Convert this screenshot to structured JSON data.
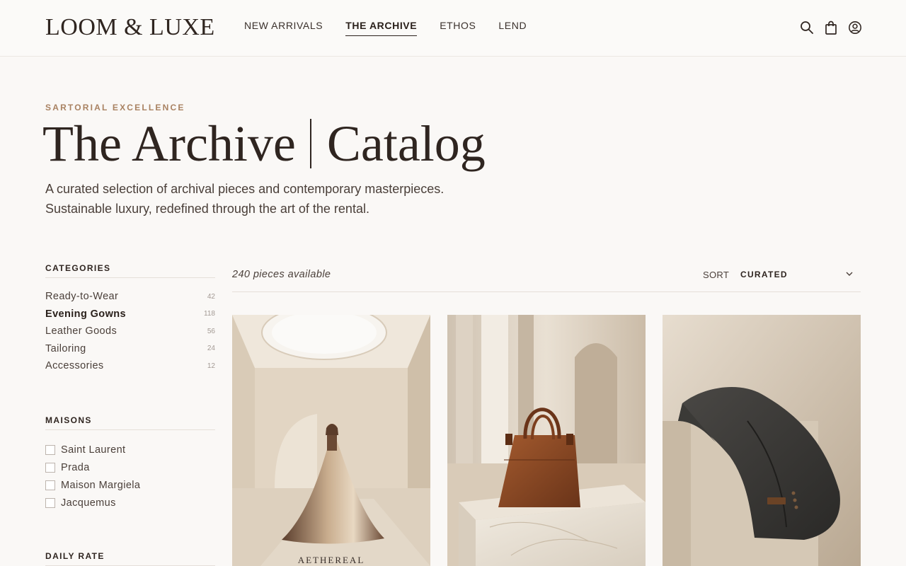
{
  "brand": {
    "logo": "LOOM & LUXE"
  },
  "nav": {
    "items": [
      {
        "label": "NEW ARRIVALS",
        "active": false
      },
      {
        "label": "THE ARCHIVE",
        "active": true
      },
      {
        "label": "ETHOS",
        "active": false
      },
      {
        "label": "LEND",
        "active": false
      }
    ]
  },
  "header_icons": [
    "search-icon",
    "bag-icon",
    "account-icon"
  ],
  "hero": {
    "eyebrow": "SARTORIAL EXCELLENCE",
    "title_left": "The Archive",
    "title_right": "Catalog",
    "subtitle_line1": "A curated selection of archival pieces and contemporary masterpieces.",
    "subtitle_line2": "Sustainable luxury, redefined through the art of the rental."
  },
  "sidebar": {
    "categories_heading": "CATEGORIES",
    "categories": [
      {
        "label": "Ready-to-Wear",
        "count": "42",
        "active": false
      },
      {
        "label": "Evening Gowns",
        "count": "118",
        "active": true
      },
      {
        "label": "Leather Goods",
        "count": "56",
        "active": false
      },
      {
        "label": "Tailoring",
        "count": "24",
        "active": false
      },
      {
        "label": "Accessories",
        "count": "12",
        "active": false
      }
    ],
    "maisons_heading": "MAISONS",
    "maisons": [
      {
        "label": "Saint Laurent",
        "checked": false
      },
      {
        "label": "Prada",
        "checked": false
      },
      {
        "label": "Maison Margiela",
        "checked": false
      },
      {
        "label": "Jacquemus",
        "checked": false
      }
    ],
    "rate_heading": "DAILY RATE"
  },
  "toolbar": {
    "count_text": "240 pieces available",
    "sort_label": "SORT",
    "sort_value": "CURATED"
  },
  "products": [
    {
      "image": "gown-in-skylit-atrium",
      "brand_text": "AETHEREAL"
    },
    {
      "image": "cognac-leather-handbag-on-marble",
      "brand_text": ""
    },
    {
      "image": "charcoal-tweed-jacket-draped",
      "brand_text": ""
    }
  ],
  "colors": {
    "background": "#faf8f6",
    "text": "#2f2520",
    "accent": "#a98262"
  }
}
